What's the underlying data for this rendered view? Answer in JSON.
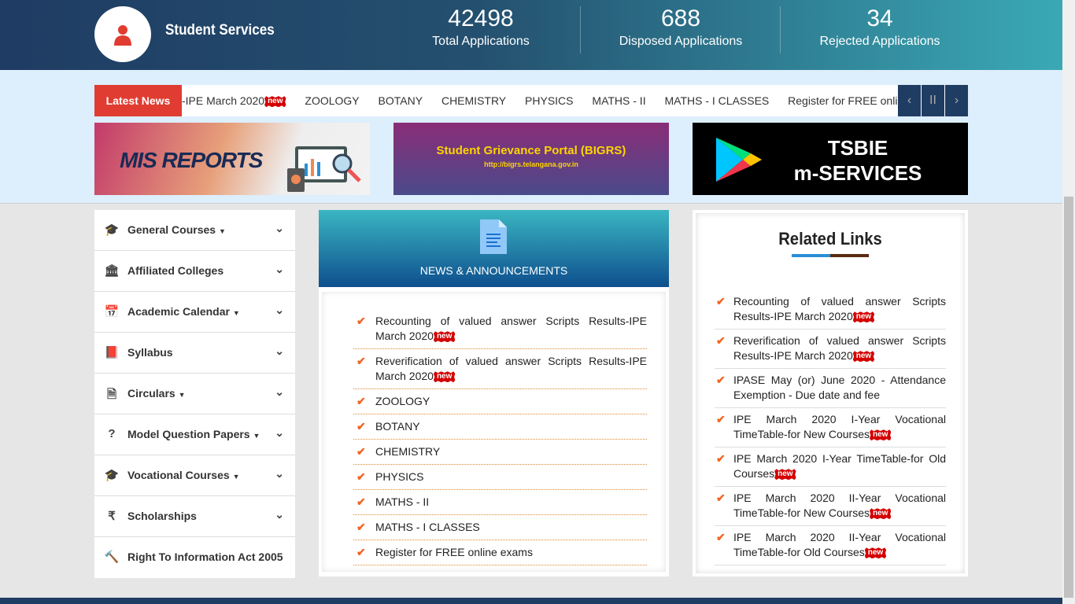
{
  "header": {
    "title": "Student Services",
    "stats": [
      {
        "value": "42498",
        "label": "Total Applications"
      },
      {
        "value": "688",
        "label": "Disposed Applications"
      },
      {
        "value": "34",
        "label": "Rejected Applications"
      }
    ]
  },
  "ticker": {
    "label": "Latest News",
    "items": [
      "-IPE March 2020",
      "ZOOLOGY",
      "BOTANY",
      "CHEMISTRY",
      "PHYSICS",
      "MATHS - II",
      "MATHS - I CLASSES",
      "Register for FREE online e"
    ],
    "new_badge": "new",
    "prev": "‹",
    "pause": "II",
    "next": "›"
  },
  "banners": {
    "mis": "MIS REPORTS",
    "grievance_title": "Student Grievance Portal (BIGRS)",
    "grievance_url": "http://bigrs.telangana.gov.in",
    "mservices_line1": "TSBIE",
    "mservices_line2": "m-SERVICES"
  },
  "sidebar": {
    "items": [
      {
        "icon": "graduation-cap",
        "label": "General Courses",
        "caret": true
      },
      {
        "icon": "institution",
        "label": "Affiliated Colleges",
        "caret": false
      },
      {
        "icon": "calendar",
        "label": "Academic Calendar",
        "caret": true
      },
      {
        "icon": "book",
        "label": "Syllabus",
        "caret": false
      },
      {
        "icon": "document",
        "label": "Circulars",
        "caret": true
      },
      {
        "icon": "question",
        "label": "Model Question Papers",
        "caret": true
      },
      {
        "icon": "graduation-cap",
        "label": "Vocational Courses",
        "caret": true
      },
      {
        "icon": "rupee",
        "label": "Scholarships",
        "caret": false
      },
      {
        "icon": "gavel",
        "label": "Right To Information Act 2005",
        "caret": false
      }
    ]
  },
  "news": {
    "title": "NEWS & ANNOUNCEMENTS",
    "items": [
      {
        "text": "Recounting of valued answer Scripts Results-IPE March 2020",
        "new": true
      },
      {
        "text": "Reverification of valued answer Scripts Results-IPE March 2020",
        "new": true
      },
      {
        "text": "ZOOLOGY",
        "new": false
      },
      {
        "text": "BOTANY",
        "new": false
      },
      {
        "text": "CHEMISTRY",
        "new": false
      },
      {
        "text": "PHYSICS",
        "new": false
      },
      {
        "text": "MATHS - II",
        "new": false
      },
      {
        "text": "MATHS - I CLASSES",
        "new": false
      },
      {
        "text": "Register for FREE online exams",
        "new": false
      }
    ]
  },
  "related": {
    "title": "Related Links",
    "items": [
      {
        "text": "Recounting of valued answer Scripts Results-IPE March 2020",
        "new": true
      },
      {
        "text": "Reverification of valued answer Scripts Results-IPE March 2020",
        "new": true
      },
      {
        "text": "IPASE May (or) June 2020 - Attendance Exemption - Due date and fee",
        "new": false
      },
      {
        "text": "IPE March 2020 I-Year Vocational TimeTable-for New Courses",
        "new": true
      },
      {
        "text": "IPE March 2020 I-Year TimeTable-for Old Courses",
        "new": true
      },
      {
        "text": "IPE March 2020 II-Year Vocational TimeTable-for New Courses",
        "new": true
      },
      {
        "text": "IPE March 2020 II-Year Vocational TimeTable-for Old Courses",
        "new": true
      }
    ]
  }
}
